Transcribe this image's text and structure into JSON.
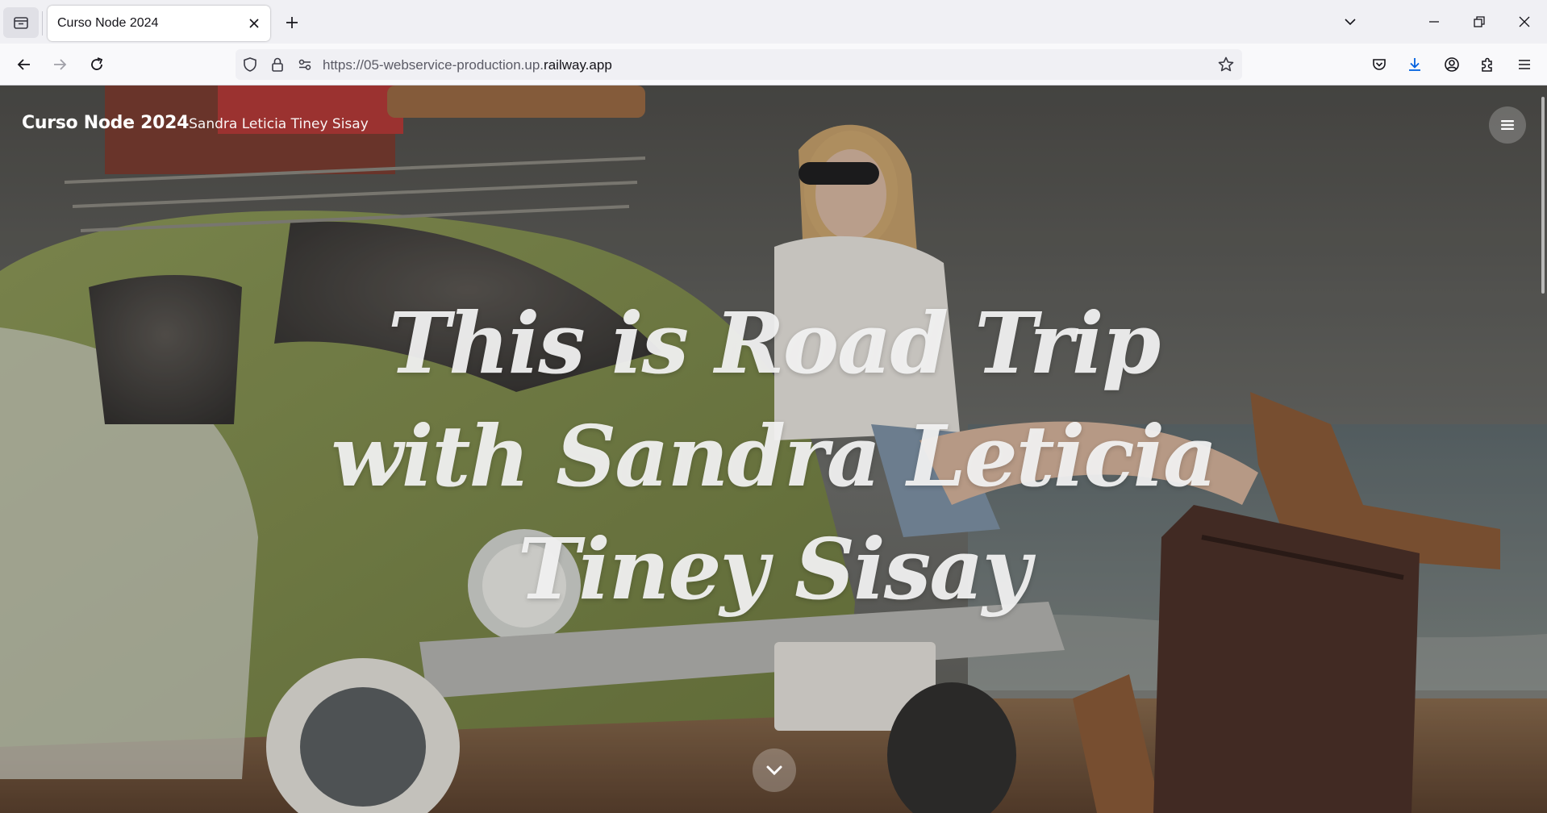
{
  "browser": {
    "tab": {
      "title": "Curso Node 2024"
    },
    "url": {
      "prefix": "https://05-webservice-production.up.",
      "domain": "railway.app"
    }
  },
  "site": {
    "title": "Curso Node 2024",
    "author": "Sandra Leticia Tiney Sisay",
    "hero_heading": "This is Road Trip with Sandra Leticia Tiney Sisay"
  },
  "icons": {
    "tab_overview": "tab-overview-icon",
    "close_tab": "close-icon",
    "new_tab": "plus-icon",
    "list_all_tabs": "chevron-down-icon",
    "minimize": "minimize-icon",
    "restore": "restore-icon",
    "close_window": "close-icon",
    "back": "arrow-left-icon",
    "forward": "arrow-right-icon",
    "reload": "reload-icon",
    "tracking_protection": "shield-icon",
    "secure": "lock-icon",
    "permissions": "permissions-icon",
    "bookmark": "star-icon",
    "pocket": "pocket-icon",
    "downloads": "download-icon",
    "account": "account-icon",
    "extensions": "puzzle-icon",
    "app_menu": "hamburger-icon",
    "site_menu": "hamburger-icon",
    "scroll_down": "chevron-down-icon"
  },
  "colors": {
    "download_accent": "#0061e0",
    "hero_text": "#f2f2f2"
  }
}
